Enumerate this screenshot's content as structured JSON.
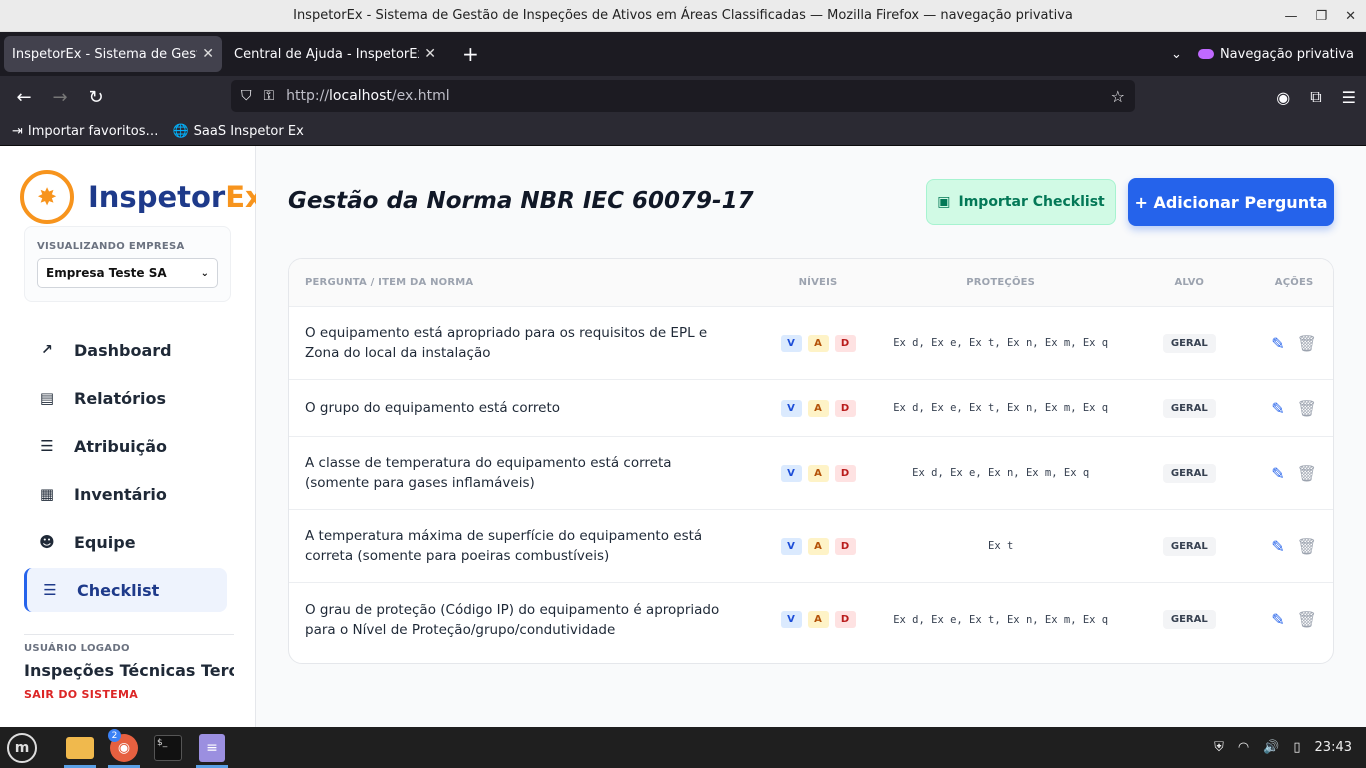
{
  "window": {
    "title": "InspetorEx - Sistema de Gestão de Inspeções de Ativos em Áreas Classificadas — Mozilla Firefox — navegação privativa"
  },
  "browser": {
    "tabs": [
      {
        "label": "InspetorEx - Sistema de Gestão de",
        "active": true
      },
      {
        "label": "Central de Ajuda - InspetorEx",
        "active": false
      }
    ],
    "private_label": "Navegação privativa",
    "url_prefix": "http://",
    "url_host": "localhost",
    "url_path": "/ex.html",
    "bookmarks": [
      {
        "label": "Importar favoritos…",
        "icon": "import-icon"
      },
      {
        "label": "SaaS Inspetor Ex",
        "icon": "globe-icon"
      }
    ]
  },
  "sidebar": {
    "logo": {
      "part1": "Inspetor",
      "part2": "Ex"
    },
    "company": {
      "label": "VISUALIZANDO EMPRESA",
      "selected": "Empresa Teste SA"
    },
    "menu": [
      {
        "label": "Dashboard",
        "icon": "chart-line-icon",
        "glyph": "📈",
        "active": false
      },
      {
        "label": "Relatórios",
        "icon": "file-icon",
        "glyph": "▤",
        "active": false
      },
      {
        "label": "Atribuição",
        "icon": "list-check-icon",
        "glyph": "☰",
        "active": false
      },
      {
        "label": "Inventário",
        "icon": "boxes-icon",
        "glyph": "▦",
        "active": false
      },
      {
        "label": "Equipe",
        "icon": "users-icon",
        "glyph": "👥",
        "active": false
      },
      {
        "label": "Checklist",
        "icon": "list-check-icon",
        "glyph": "☰",
        "active": true
      }
    ],
    "user": {
      "label": "USUÁRIO LOGADO",
      "name": "Inspeções Técnicas Terce...",
      "logout": "SAIR DO SISTEMA"
    }
  },
  "main": {
    "title": "Gestão da Norma NBR IEC 60079-17",
    "import_button": "Importar Checklist",
    "add_button": "+ Adicionar Pergunta",
    "table": {
      "headers": [
        "PERGUNTA / ITEM DA NORMA",
        "NÍVEIS",
        "PROTEÇÕES",
        "ALVO",
        "AÇÕES"
      ],
      "rows": [
        {
          "question": "O equipamento está apropriado para os requisitos de EPL e Zona do local da instalação",
          "levels": [
            "V",
            "A",
            "D"
          ],
          "protections": "Ex d, Ex e, Ex t, Ex n, Ex m, Ex q",
          "target": "GERAL"
        },
        {
          "question": "O grupo do equipamento está correto",
          "levels": [
            "V",
            "A",
            "D"
          ],
          "protections": "Ex d, Ex e, Ex t, Ex n, Ex m, Ex q",
          "target": "GERAL"
        },
        {
          "question": "A classe de temperatura do equipamento está correta (somente para gases inflamáveis)",
          "levels": [
            "V",
            "A",
            "D"
          ],
          "protections": "Ex d, Ex e, Ex n, Ex m, Ex q",
          "target": "GERAL"
        },
        {
          "question": "A temperatura máxima de superfície do equipamento está correta (somente para poeiras combustíveis)",
          "levels": [
            "V",
            "A",
            "D"
          ],
          "protections": "Ex t",
          "target": "GERAL"
        },
        {
          "question": "O grau de proteção (Código IP) do equipamento é apropriado para o Nível de Proteção/grupo/condutividade",
          "levels": [
            "V",
            "A",
            "D"
          ],
          "protections": "Ex d, Ex e, Ex t, Ex n, Ex m, Ex q",
          "target": "GERAL"
        }
      ]
    }
  },
  "taskbar": {
    "clock": "23:43",
    "firefox_badge": "2"
  }
}
